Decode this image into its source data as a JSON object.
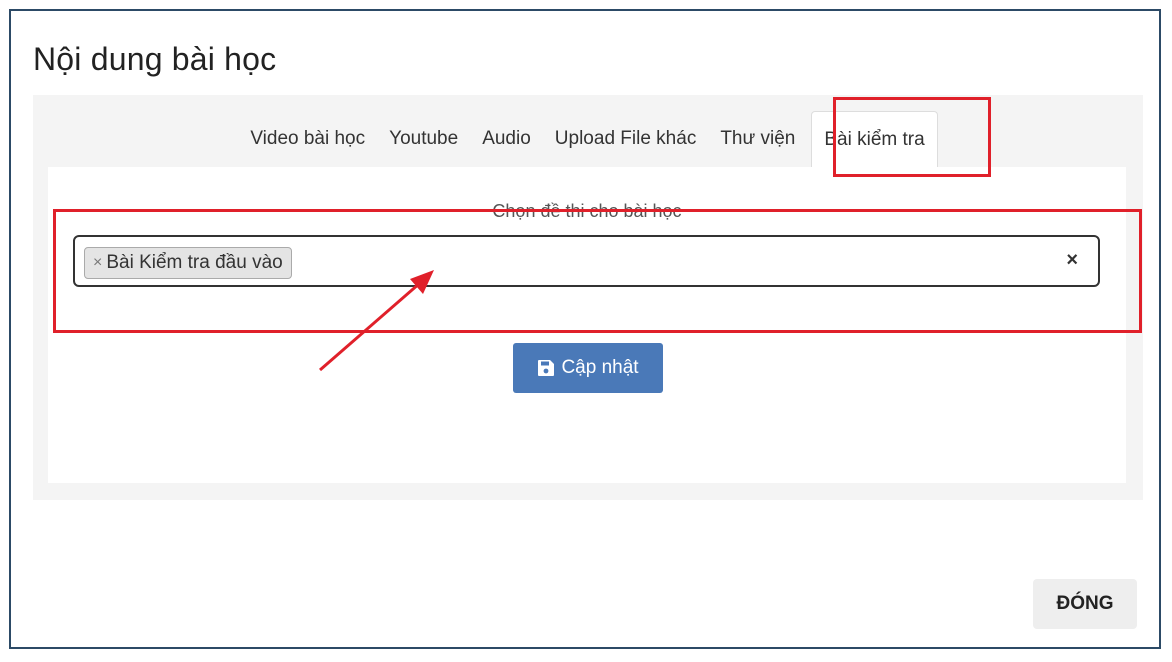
{
  "modal": {
    "title": "Nội dung bài học",
    "close_label": "ĐÓNG"
  },
  "tabs": [
    {
      "label": "Video bài học",
      "active": false
    },
    {
      "label": "Youtube",
      "active": false
    },
    {
      "label": "Audio",
      "active": false
    },
    {
      "label": "Upload File khác",
      "active": false
    },
    {
      "label": "Thư viện",
      "active": false
    },
    {
      "label": "Bài kiểm tra",
      "active": true
    }
  ],
  "exam": {
    "prompt": "Chọn đề thi cho bài học",
    "selected": [
      {
        "label": "Bài Kiểm tra đầu vào",
        "remove_glyph": "×"
      }
    ],
    "clear_glyph": "×",
    "update_label": "Cập nhật",
    "update_icon": "save-icon"
  },
  "colors": {
    "highlight": "#e0202a",
    "primary_button": "#4a79b8",
    "frame_border": "#2c4a66"
  }
}
